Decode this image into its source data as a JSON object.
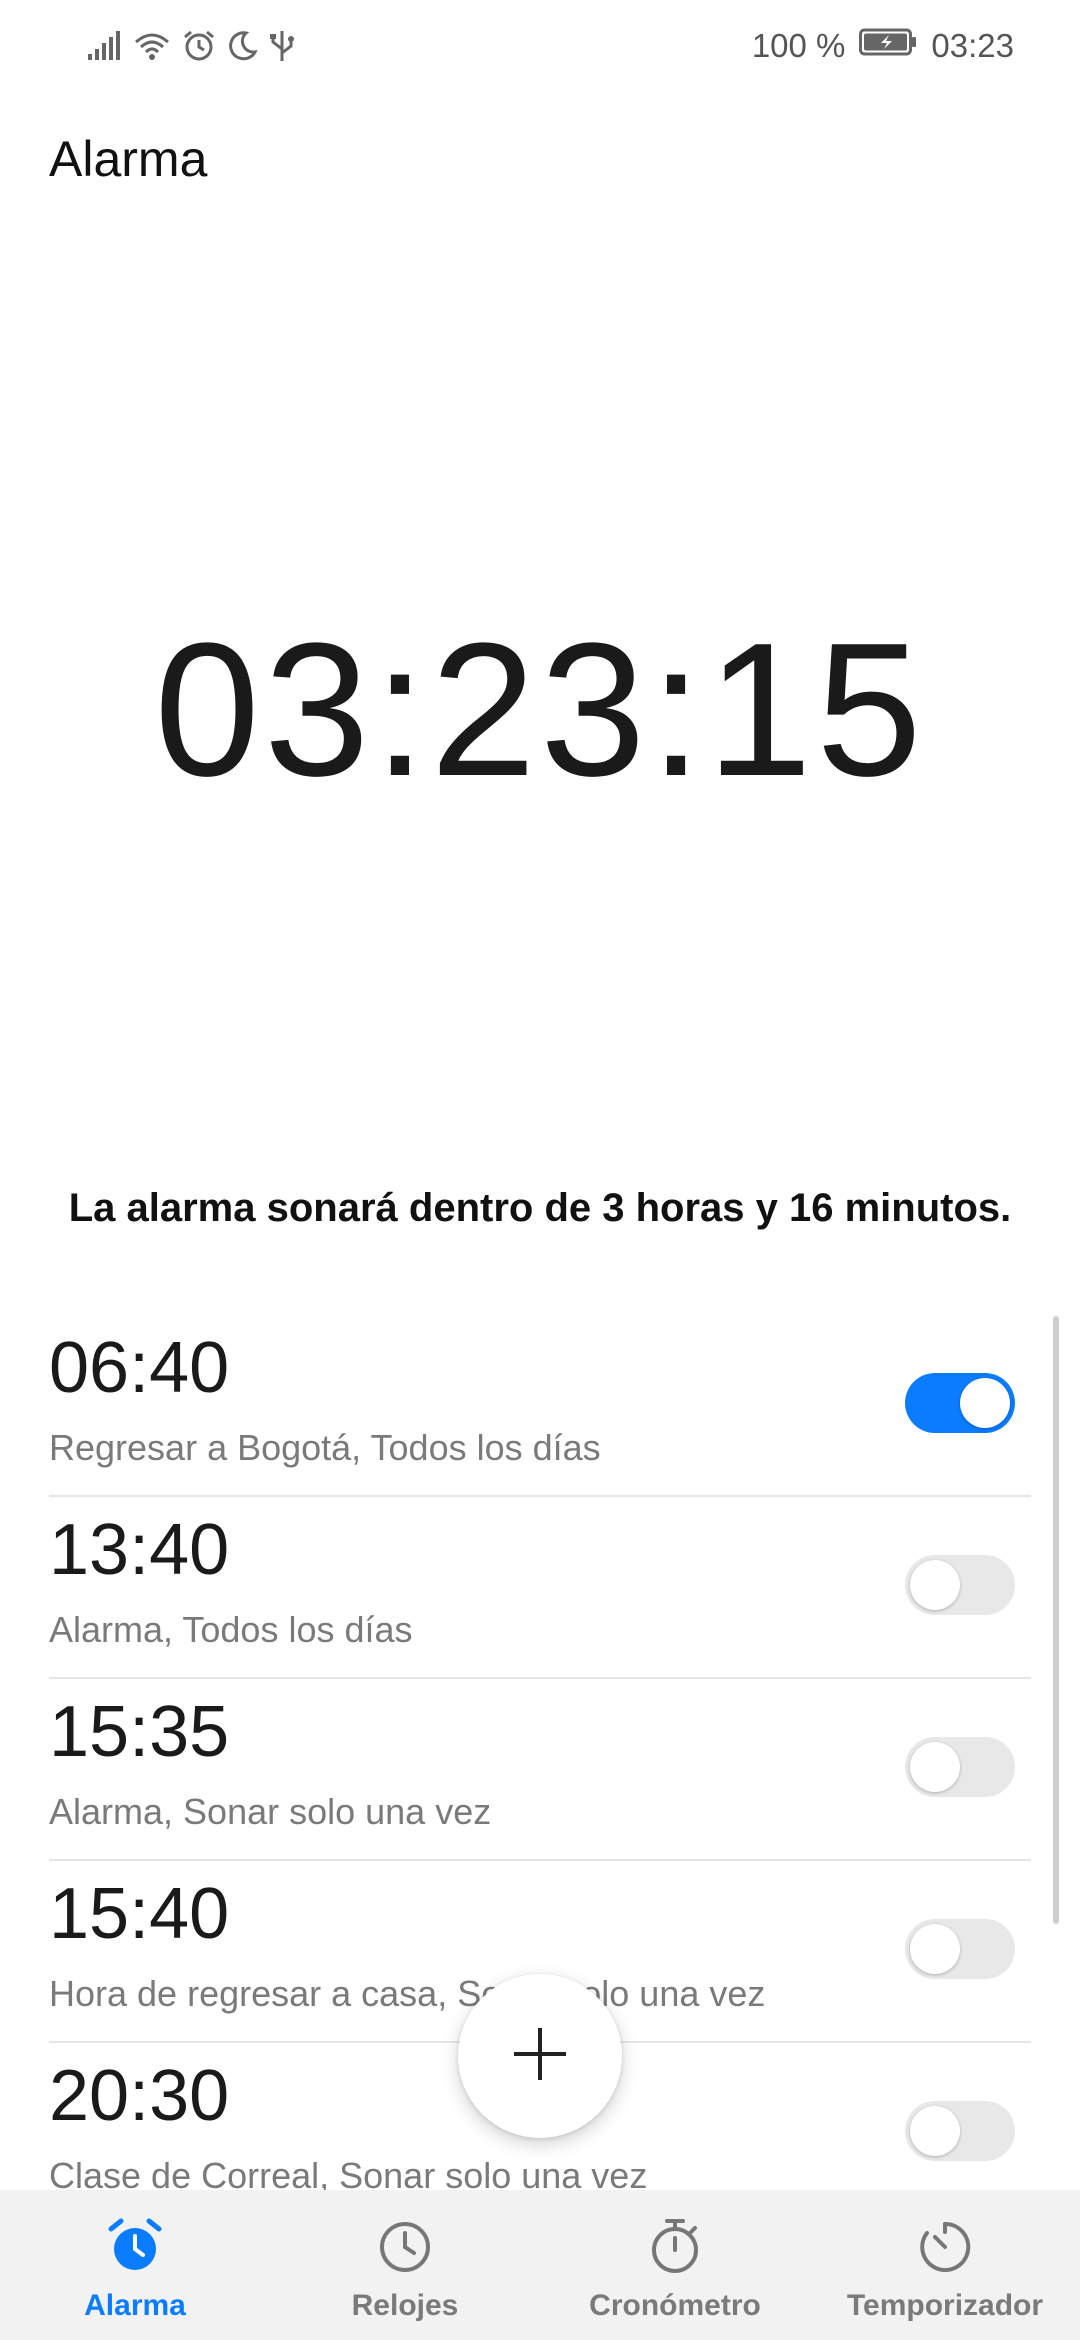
{
  "status_bar": {
    "battery_percent": "100 %",
    "time": "03:23",
    "icons": [
      "signal-icon",
      "wifi-icon",
      "alarm-clock-icon",
      "moon-icon",
      "usb-icon"
    ]
  },
  "header": {
    "title": "Alarma"
  },
  "clock": {
    "time": "03:23:15"
  },
  "next_alarm_text": "La alarma sonará dentro de 3 horas y 16 minutos.",
  "alarms": [
    {
      "time": "06:40",
      "label": "Regresar a Bogotá, Todos los días",
      "enabled": true
    },
    {
      "time": "13:40",
      "label": "Alarma, Todos los días",
      "enabled": false
    },
    {
      "time": "15:35",
      "label": "Alarma, Sonar solo una vez",
      "enabled": false
    },
    {
      "time": "15:40",
      "label": "Hora de regresar a casa, Sonar solo una vez",
      "enabled": false
    },
    {
      "time": "20:30",
      "label": "Clase de Correal, Sonar solo una vez",
      "enabled": false
    }
  ],
  "fab": {
    "icon": "plus-icon"
  },
  "nav": {
    "items": [
      {
        "label": "Alarma",
        "icon": "alarm-clock-icon",
        "active": true
      },
      {
        "label": "Relojes",
        "icon": "clock-icon",
        "active": false
      },
      {
        "label": "Cronómetro",
        "icon": "stopwatch-icon",
        "active": false
      },
      {
        "label": "Temporizador",
        "icon": "timer-icon",
        "active": false
      }
    ]
  },
  "colors": {
    "accent": "#0a7cff",
    "toggle_off": "#e8e8e8",
    "secondary_text": "#7a7a7a",
    "nav_background": "#f2f2f2"
  }
}
